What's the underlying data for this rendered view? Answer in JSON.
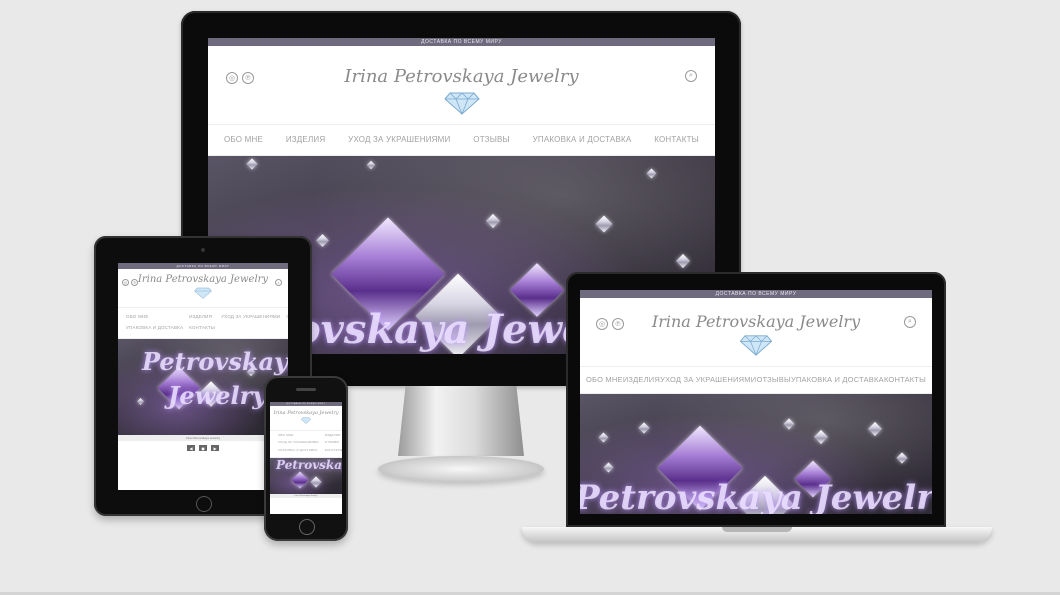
{
  "site": {
    "topbar_text": "ДОСТАВКА ПО ВСЕМУ МИРУ",
    "brand": "Irina Petrovskaya Jewelry",
    "nav": [
      "ОБО МНЕ",
      "ИЗДЕЛИЯ",
      "УХОД ЗА УКРАШЕНИЯМИ",
      "ОТЗЫВЫ",
      "УПАКОВКА И ДОСТАВКА",
      "КОНТАКТЫ"
    ],
    "hero_text_line1": "Petrovskaya",
    "hero_text_line2": "Jewelry",
    "hero_text_full": "Petrovskaya Jewelry",
    "tablet_strip_text": "Irina Petrovskaya Jewelry",
    "tablet_buttons": [
      "◀",
      "◼",
      "▶"
    ]
  },
  "devices": [
    "monitor",
    "tablet",
    "phone",
    "laptop"
  ],
  "colors": {
    "topbar": "#6f6a7d",
    "background": "#e9e9e9",
    "nav_text": "#a2a2a2",
    "brand_text": "#8a8a8a",
    "hero_glow": "#a878dc"
  },
  "icons": {
    "social_left": "instagram-icon",
    "social_right": "pinterest-icon",
    "search": "search-icon",
    "logo": "diamond-icon"
  }
}
